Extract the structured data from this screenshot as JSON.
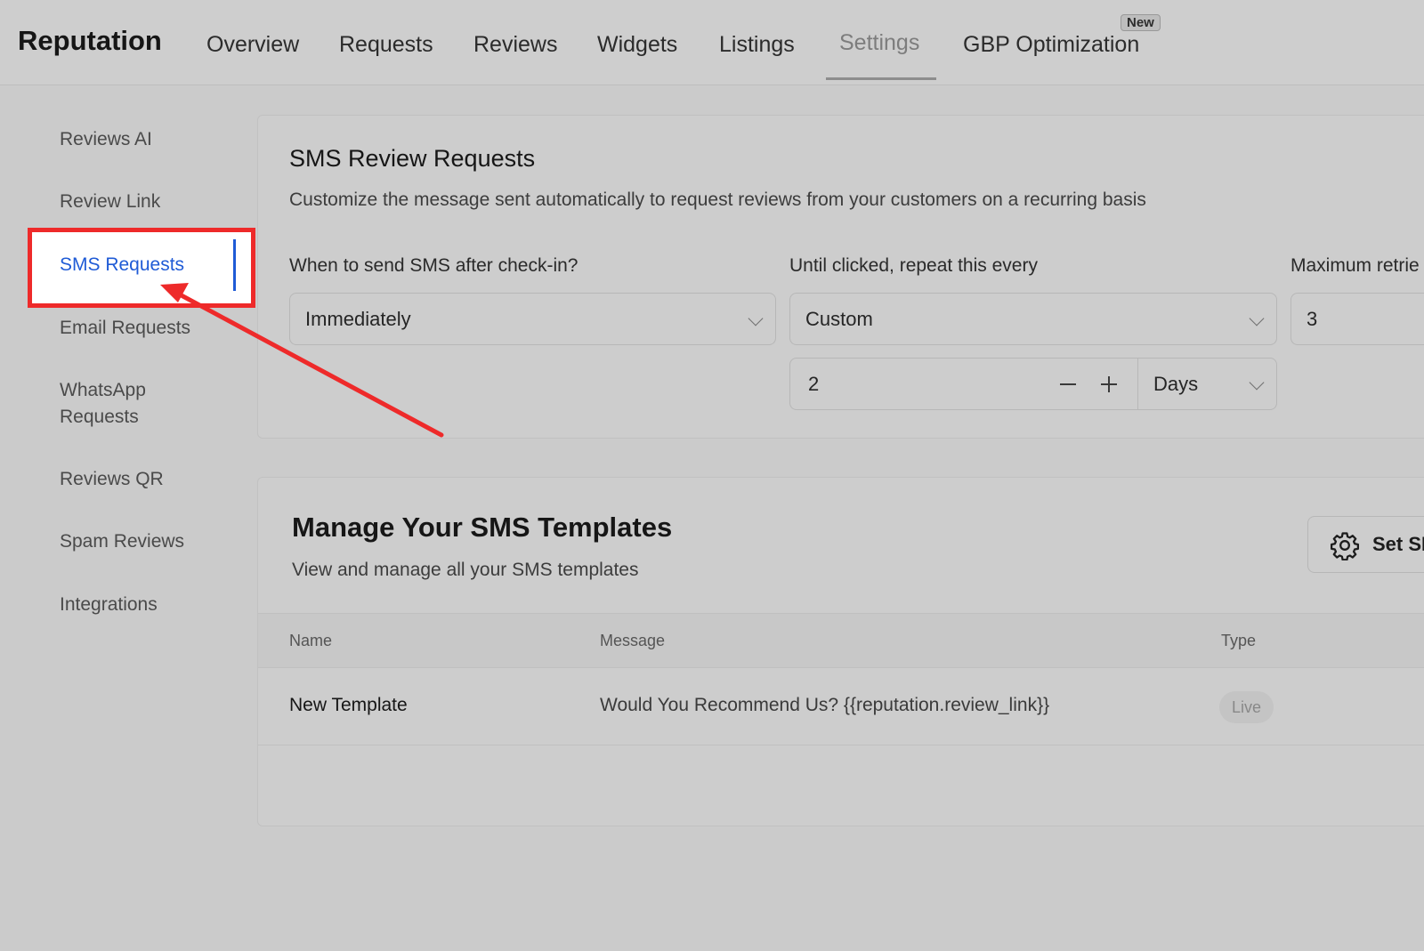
{
  "header": {
    "title": "Reputation",
    "tabs": [
      {
        "label": "Overview"
      },
      {
        "label": "Requests"
      },
      {
        "label": "Reviews"
      },
      {
        "label": "Widgets"
      },
      {
        "label": "Listings"
      },
      {
        "label": "Settings",
        "active": true
      },
      {
        "label": "GBP Optimization",
        "badge": "New"
      }
    ]
  },
  "sidebar": {
    "items": [
      {
        "label": "Reviews AI"
      },
      {
        "label": "Review Link"
      },
      {
        "label": "SMS Requests",
        "active": true
      },
      {
        "label": "Email Requests"
      },
      {
        "label": "WhatsApp Requests"
      },
      {
        "label": "Reviews QR"
      },
      {
        "label": "Spam Reviews"
      },
      {
        "label": "Integrations"
      }
    ]
  },
  "sms_settings": {
    "title": "SMS Review Requests",
    "subtitle": "Customize the message sent automatically to request reviews from your customers on a recurring basis",
    "when_label": "When to send SMS after check-in?",
    "when_value": "Immediately",
    "repeat_label": "Until clicked, repeat this every",
    "repeat_value": "Custom",
    "repeat_count": "2",
    "repeat_unit": "Days",
    "max_label": "Maximum retrie",
    "max_value": "3"
  },
  "templates": {
    "title": "Manage Your SMS Templates",
    "subtitle": "View and manage all your SMS templates",
    "settings_button": "Set SI",
    "columns": [
      "Name",
      "Message",
      "Type"
    ],
    "rows": [
      {
        "name": "New Template",
        "message": "Would You Recommend Us? {{reputation.review_link}}",
        "type": "Live"
      }
    ]
  },
  "annotation": {
    "color": "#ee2a2a"
  }
}
